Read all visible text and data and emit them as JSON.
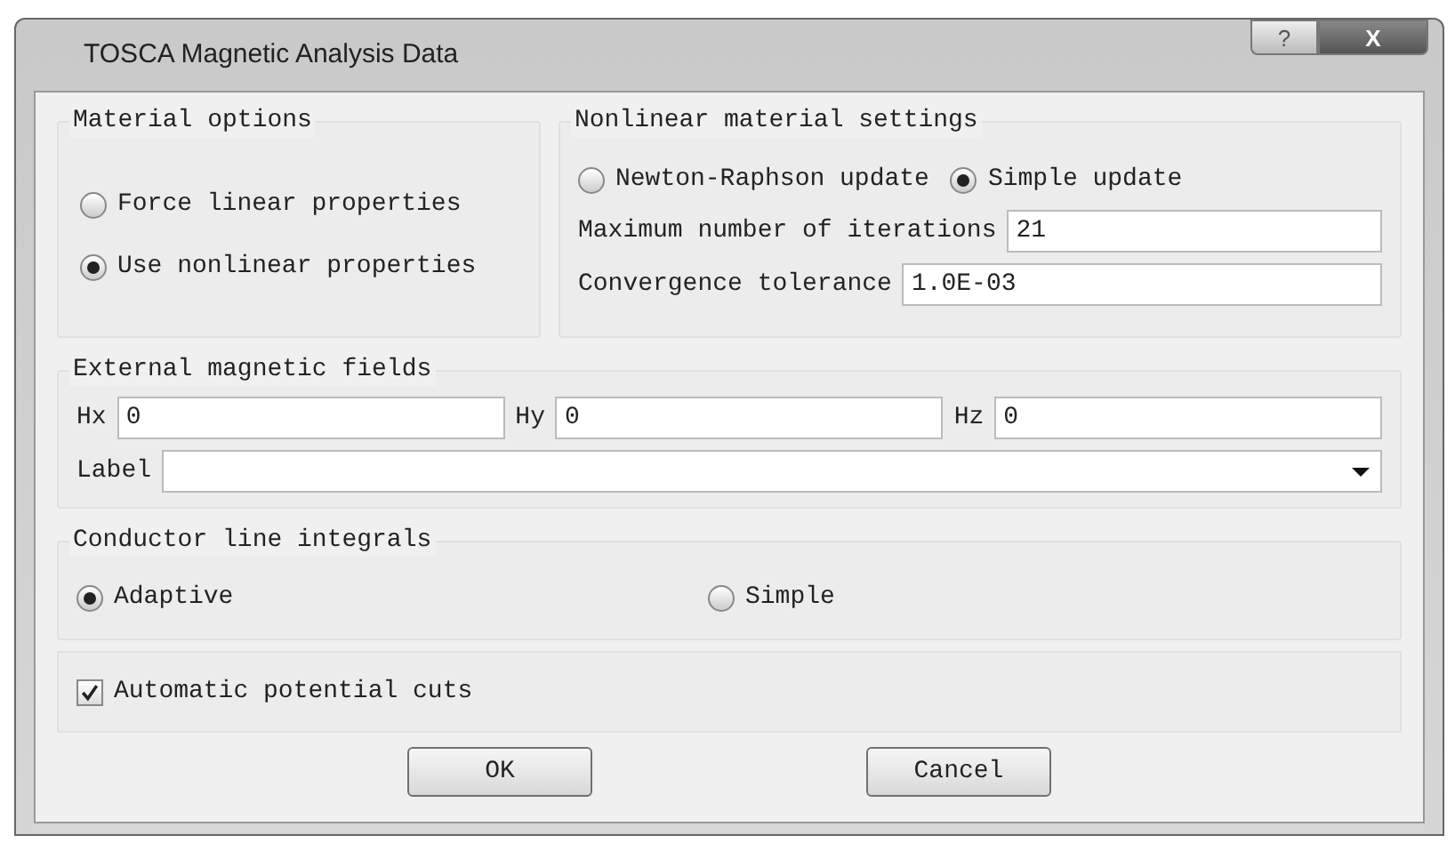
{
  "window": {
    "title": "TOSCA Magnetic Analysis Data",
    "buttons": [
      "?",
      "X"
    ]
  },
  "material_options": {
    "title": "Material options",
    "options": [
      {
        "label": "Force linear properties",
        "selected": false
      },
      {
        "label": "Use nonlinear properties",
        "selected": true
      }
    ]
  },
  "nonlinear_settings": {
    "title": "Nonlinear material settings",
    "update_methods": [
      {
        "label": "Newton-Raphson update",
        "selected": false
      },
      {
        "label": "Simple update",
        "selected": true
      }
    ],
    "fields": [
      {
        "label": "Maximum number of iterations",
        "value": "21"
      },
      {
        "label": "Convergence tolerance",
        "value": "1.0E-03"
      }
    ]
  },
  "external_fields": {
    "title": "External magnetic fields",
    "fields": [
      {
        "label": "Hx",
        "value": "0"
      },
      {
        "label": "Hy",
        "value": "0"
      },
      {
        "label": "Hz",
        "value": "0"
      }
    ],
    "label_dropdown": {
      "label": "Label"
    }
  },
  "conductor_line_integrals": {
    "title": "Conductor line integrals",
    "options": [
      {
        "label": "Adaptive",
        "selected": true
      },
      {
        "label": "Simple",
        "selected": false
      }
    ]
  },
  "automatic_potential_cuts": {
    "label": "Automatic potential cuts",
    "checked": true
  },
  "buttons": [
    "OK",
    "Cancel"
  ]
}
